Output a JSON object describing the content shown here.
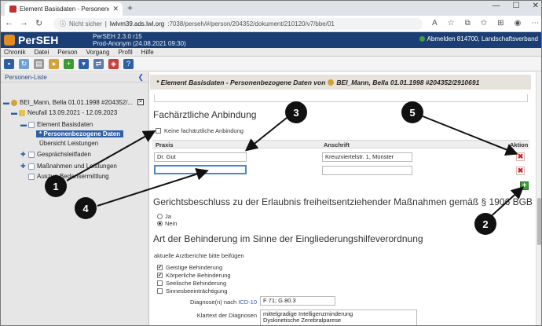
{
  "browser": {
    "tab_title": "Element Basisdaten - Personenc",
    "url_security": "Nicht sicher",
    "url_host": "lwlvm39.ads.lwl.org",
    "url_path": ":7038/perseh/#/person/204352/dokument/210120/v7/bbe/01"
  },
  "app": {
    "name": "PerSEH",
    "subname": "",
    "version": "PerSEH 2.3.0 r15",
    "environment": "Prod-Anonym (24.08.2021 09:30)",
    "logout_label": "Abmelden 814700, Landschaftsverband"
  },
  "menu": [
    "Chronik",
    "Datei",
    "Person",
    "Vorgang",
    "Profil",
    "Hilfe"
  ],
  "sidebar": {
    "title": "Personen-Liste",
    "items": [
      {
        "label": "BEI_Mann, Bella 01.01.1998 #204352/..."
      },
      {
        "label": "Neufall 13.09.2021 - 12.09.2023"
      },
      {
        "label": "Element Basisdaten"
      },
      {
        "label": "* Personenbezogene Daten"
      },
      {
        "label": "Übersicht Leistungen"
      },
      {
        "label": "Gesprächsleitfaden"
      },
      {
        "label": "Maßnahmen und Leistungen"
      },
      {
        "label": "Auszug Bedarfsermittlung"
      }
    ]
  },
  "main": {
    "title_prefix": "* Element Basisdaten - Personenbezogene Daten von",
    "title_person": "BEI_Mann, Bella 01.01.1998 #204352/2910691",
    "section1": {
      "heading": "Fachärztliche Anbindung",
      "no_doctor_checkbox": "Keine fachärztliche Anbindung",
      "columns": [
        "Praxis",
        "Anschrift",
        "Aktion"
      ],
      "rows": [
        {
          "praxis": "Dr. Gut",
          "anschrift": "Kreuzviertelstr. 1, Münster"
        },
        {
          "praxis": "",
          "anschrift": ""
        }
      ]
    },
    "section2": {
      "heading": "Gerichtsbeschluss zu der Erlaubnis freiheitsentziehender Maßnahmen gemäß § 1906 BGB",
      "options": [
        "Ja",
        "Nein"
      ],
      "selected": "Nein"
    },
    "section3": {
      "heading": "Art der Behinderung im Sinne der Eingliederungshilfeverordnung",
      "note": "aktuelle Arztberichte bitte beifügen",
      "checkboxes": [
        {
          "label": "Geistige Behinderung",
          "checked": true
        },
        {
          "label": "Körperliche Behinderung",
          "checked": true
        },
        {
          "label": "Seelische Behinderung",
          "checked": false
        },
        {
          "label": "Sinnesbeeinträchtigung",
          "checked": false
        }
      ],
      "diagnose_label_prefix": "Diagnose(n) nach",
      "diagnose_label_link": "ICD-10",
      "diagnose_value": "F 71; G.80.3",
      "klartext_label": "Klartext der Diagnosen",
      "klartext_lines": [
        "mittelgradige Intelligenzminderung",
        "Dyskinetische Zerebralparese"
      ]
    }
  },
  "callouts": [
    "1",
    "2",
    "3",
    "4",
    "5"
  ]
}
